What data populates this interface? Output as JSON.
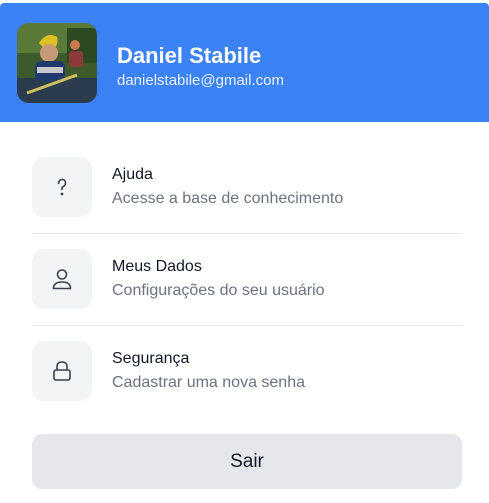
{
  "colors": {
    "header_bg": "#3b82f6",
    "icon_bg": "#f3f4f6",
    "button_bg": "#e5e7eb",
    "title_text": "#111827",
    "subtitle_text": "#6b7280"
  },
  "profile": {
    "name": "Daniel Stabile",
    "email": "danielstabile@gmail.com"
  },
  "menu": {
    "items": [
      {
        "icon": "question-icon",
        "title": "Ajuda",
        "subtitle": "Acesse a base de conhecimento"
      },
      {
        "icon": "user-icon",
        "title": "Meus Dados",
        "subtitle": "Configurações do seu usuário"
      },
      {
        "icon": "lock-icon",
        "title": "Segurança",
        "subtitle": "Cadastrar uma nova senha"
      }
    ]
  },
  "logout_label": "Sair"
}
